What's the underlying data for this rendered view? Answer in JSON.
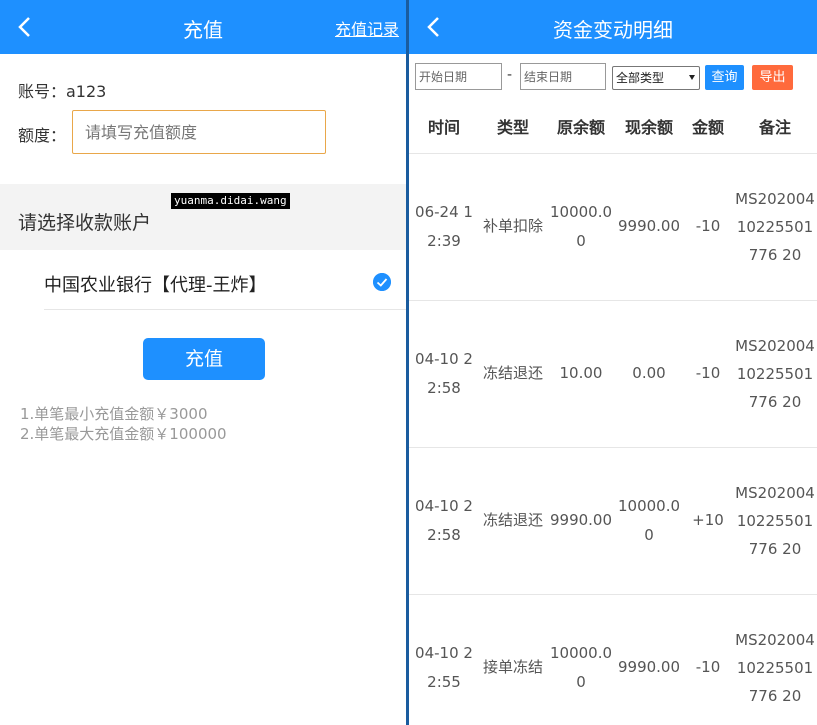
{
  "left": {
    "header": {
      "title": "充值",
      "right_link": "充值记录"
    },
    "account_line": "账号：a123",
    "amount": {
      "label": "额度：",
      "placeholder": "请填写充值额度",
      "value": ""
    },
    "section_label": "请选择收款账户",
    "watermark": "yuanma.didai.wang",
    "bank": {
      "label": "中国农业银行【代理-王炸】",
      "selected": true
    },
    "submit_label": "充值",
    "notes": [
      "1.单笔最小充值金额￥3000",
      "2.单笔最大充值金额￥100000"
    ]
  },
  "right": {
    "header": {
      "title": "资金变动明细"
    },
    "filters": {
      "start_placeholder": "开始日期",
      "dash": "-",
      "end_placeholder": "结束日期",
      "type_selected": "全部类型",
      "query_label": "查询",
      "export_label": "导出"
    },
    "table": {
      "columns": [
        "时间",
        "类型",
        "原余额",
        "现余额",
        "金额",
        "备注"
      ],
      "rows": [
        {
          "time": "06-24 12:39",
          "type": "补单扣除",
          "old_balance": "10000.00",
          "new_balance": "9990.00",
          "amount": "-10",
          "remark": "MS20200410225501776 20"
        },
        {
          "time": "04-10 22:58",
          "type": "冻结退还",
          "old_balance": "10.00",
          "new_balance": "0.00",
          "amount": "-10",
          "remark": "MS20200410225501776 20"
        },
        {
          "time": "04-10 22:58",
          "type": "冻结退还",
          "old_balance": "9990.00",
          "new_balance": "10000.00",
          "amount": "+10",
          "remark": "MS20200410225501776 20"
        },
        {
          "time": "04-10 22:55",
          "type": "接单冻结",
          "old_balance": "10000.00",
          "new_balance": "9990.00",
          "amount": "-10",
          "remark": "MS20200410225501776 20"
        }
      ]
    }
  },
  "colors": {
    "primary": "#1e90ff",
    "export": "#ff6a3c",
    "input_border": "#e9a74a"
  }
}
